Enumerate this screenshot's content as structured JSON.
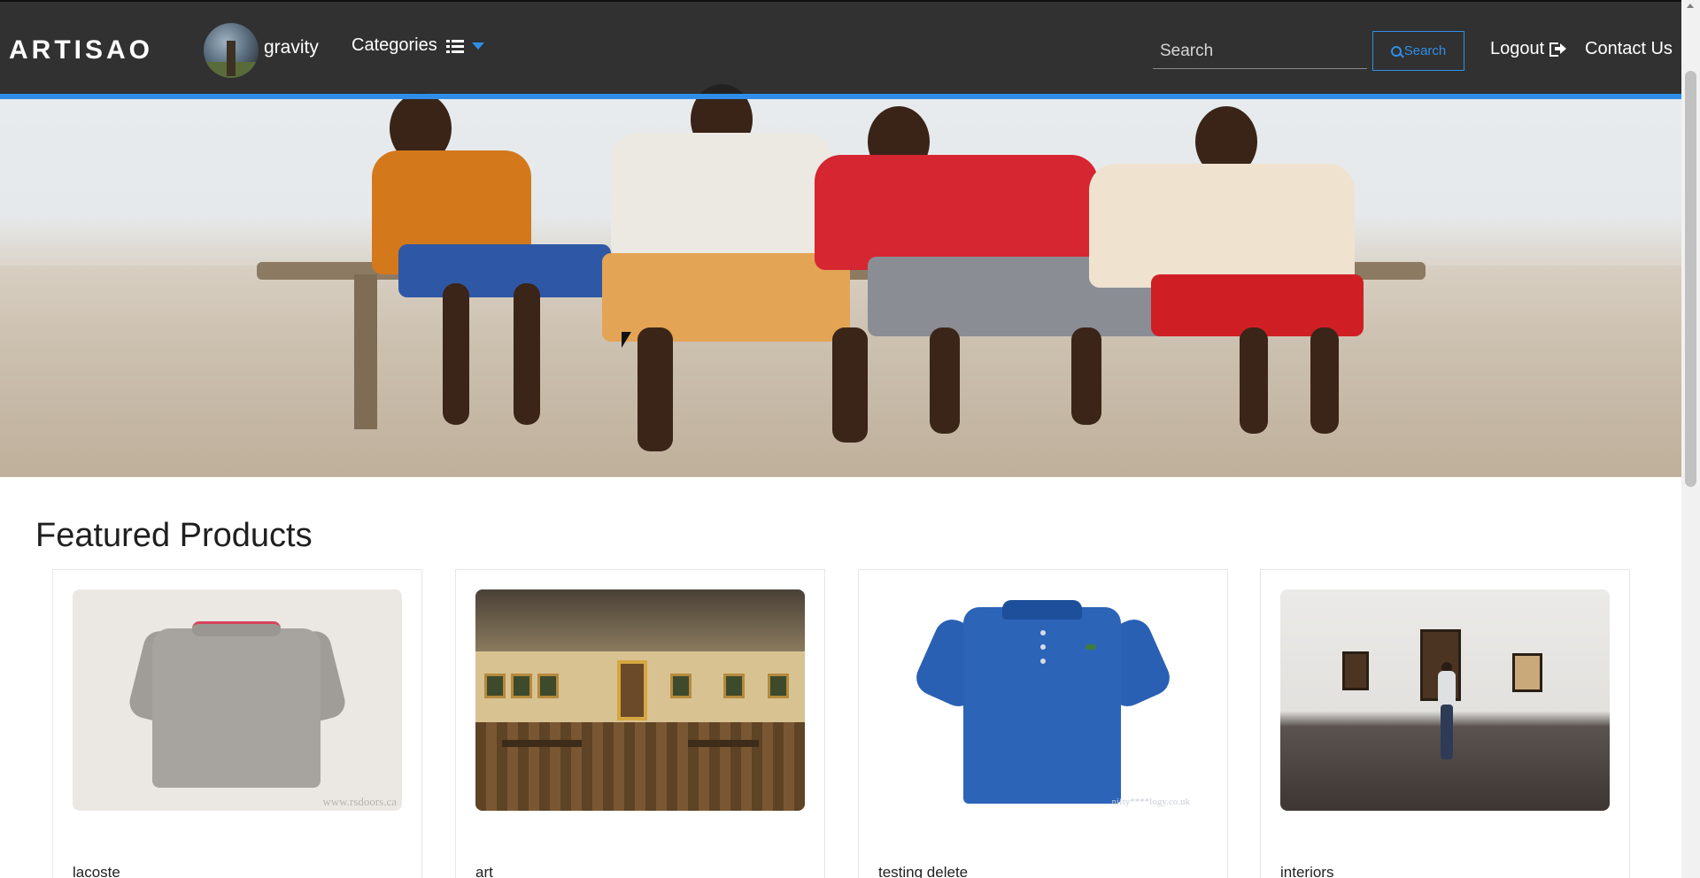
{
  "nav": {
    "brand": "ARTISAO",
    "username": "gravity",
    "categories_label": "Categories",
    "search_placeholder": "Search",
    "search_button": "Search",
    "logout_label": "Logout",
    "contact_label": "Contact Us"
  },
  "section": {
    "title": "Featured Products"
  },
  "products": [
    {
      "name": "lacoste",
      "watermark": "www.rsdoors.ca"
    },
    {
      "name": "art"
    },
    {
      "name": "testing delete",
      "watermark": "nifty****logy.co.uk"
    },
    {
      "name": "interiors"
    }
  ],
  "colors": {
    "navbar_bg": "#222222",
    "accent": "#2f8fe8",
    "text_dark": "#1f1f1f"
  }
}
